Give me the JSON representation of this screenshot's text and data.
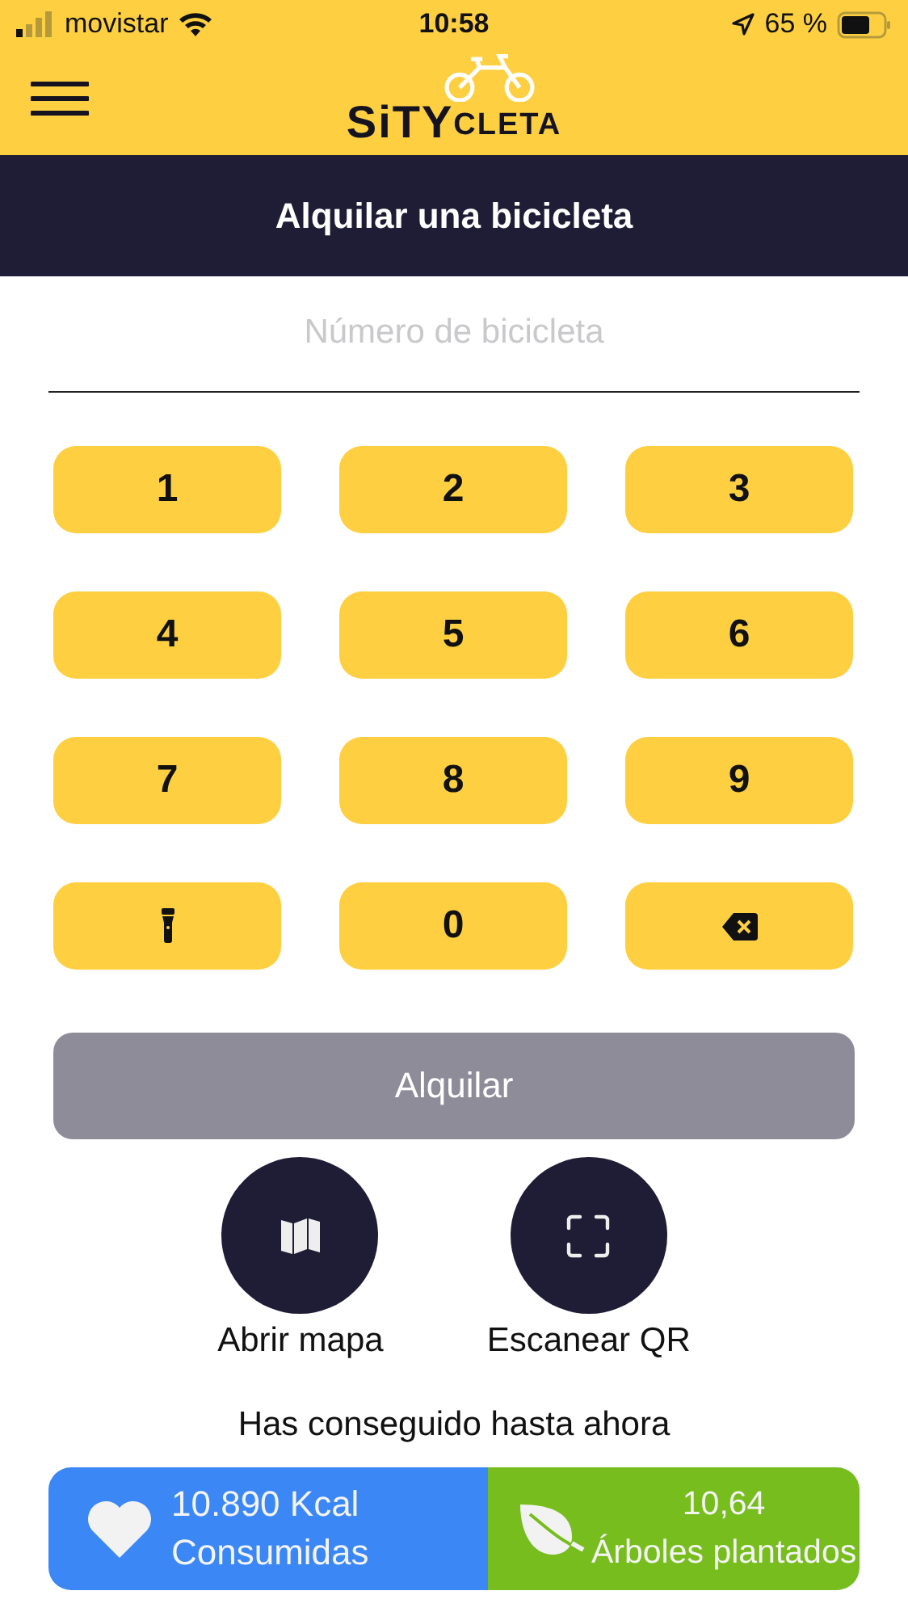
{
  "status_bar": {
    "carrier": "movistar",
    "time": "10:58",
    "battery": "65 %"
  },
  "header": {
    "logo": {
      "first": "SiTY",
      "second": "CLETA"
    }
  },
  "title": "Alquilar una bicicleta",
  "bike_number": {
    "placeholder": "Número de bicicleta"
  },
  "keypad": [
    {
      "kind": "digit",
      "label": "1"
    },
    {
      "kind": "digit",
      "label": "2"
    },
    {
      "kind": "digit",
      "label": "3"
    },
    {
      "kind": "digit",
      "label": "4"
    },
    {
      "kind": "digit",
      "label": "5"
    },
    {
      "kind": "digit",
      "label": "6"
    },
    {
      "kind": "digit",
      "label": "7"
    },
    {
      "kind": "digit",
      "label": "8"
    },
    {
      "kind": "digit",
      "label": "9"
    },
    {
      "kind": "flashlight"
    },
    {
      "kind": "digit",
      "label": "0"
    },
    {
      "kind": "backspace"
    }
  ],
  "rent_button": {
    "label": "Alquilar",
    "disabled": true
  },
  "actions": [
    {
      "kind": "map",
      "label": "Abrir mapa"
    },
    {
      "kind": "scan",
      "label": "Escanear QR"
    }
  ],
  "achievements_title": "Has conseguido hasta ahora",
  "stats": [
    {
      "kind": "heart",
      "color": "#3a87f5",
      "value": "10.890 Kcal",
      "label": "Consumidas"
    },
    {
      "kind": "leaf",
      "color": "#76bd1d",
      "value": "10,64",
      "label": "Árboles plantados"
    }
  ]
}
